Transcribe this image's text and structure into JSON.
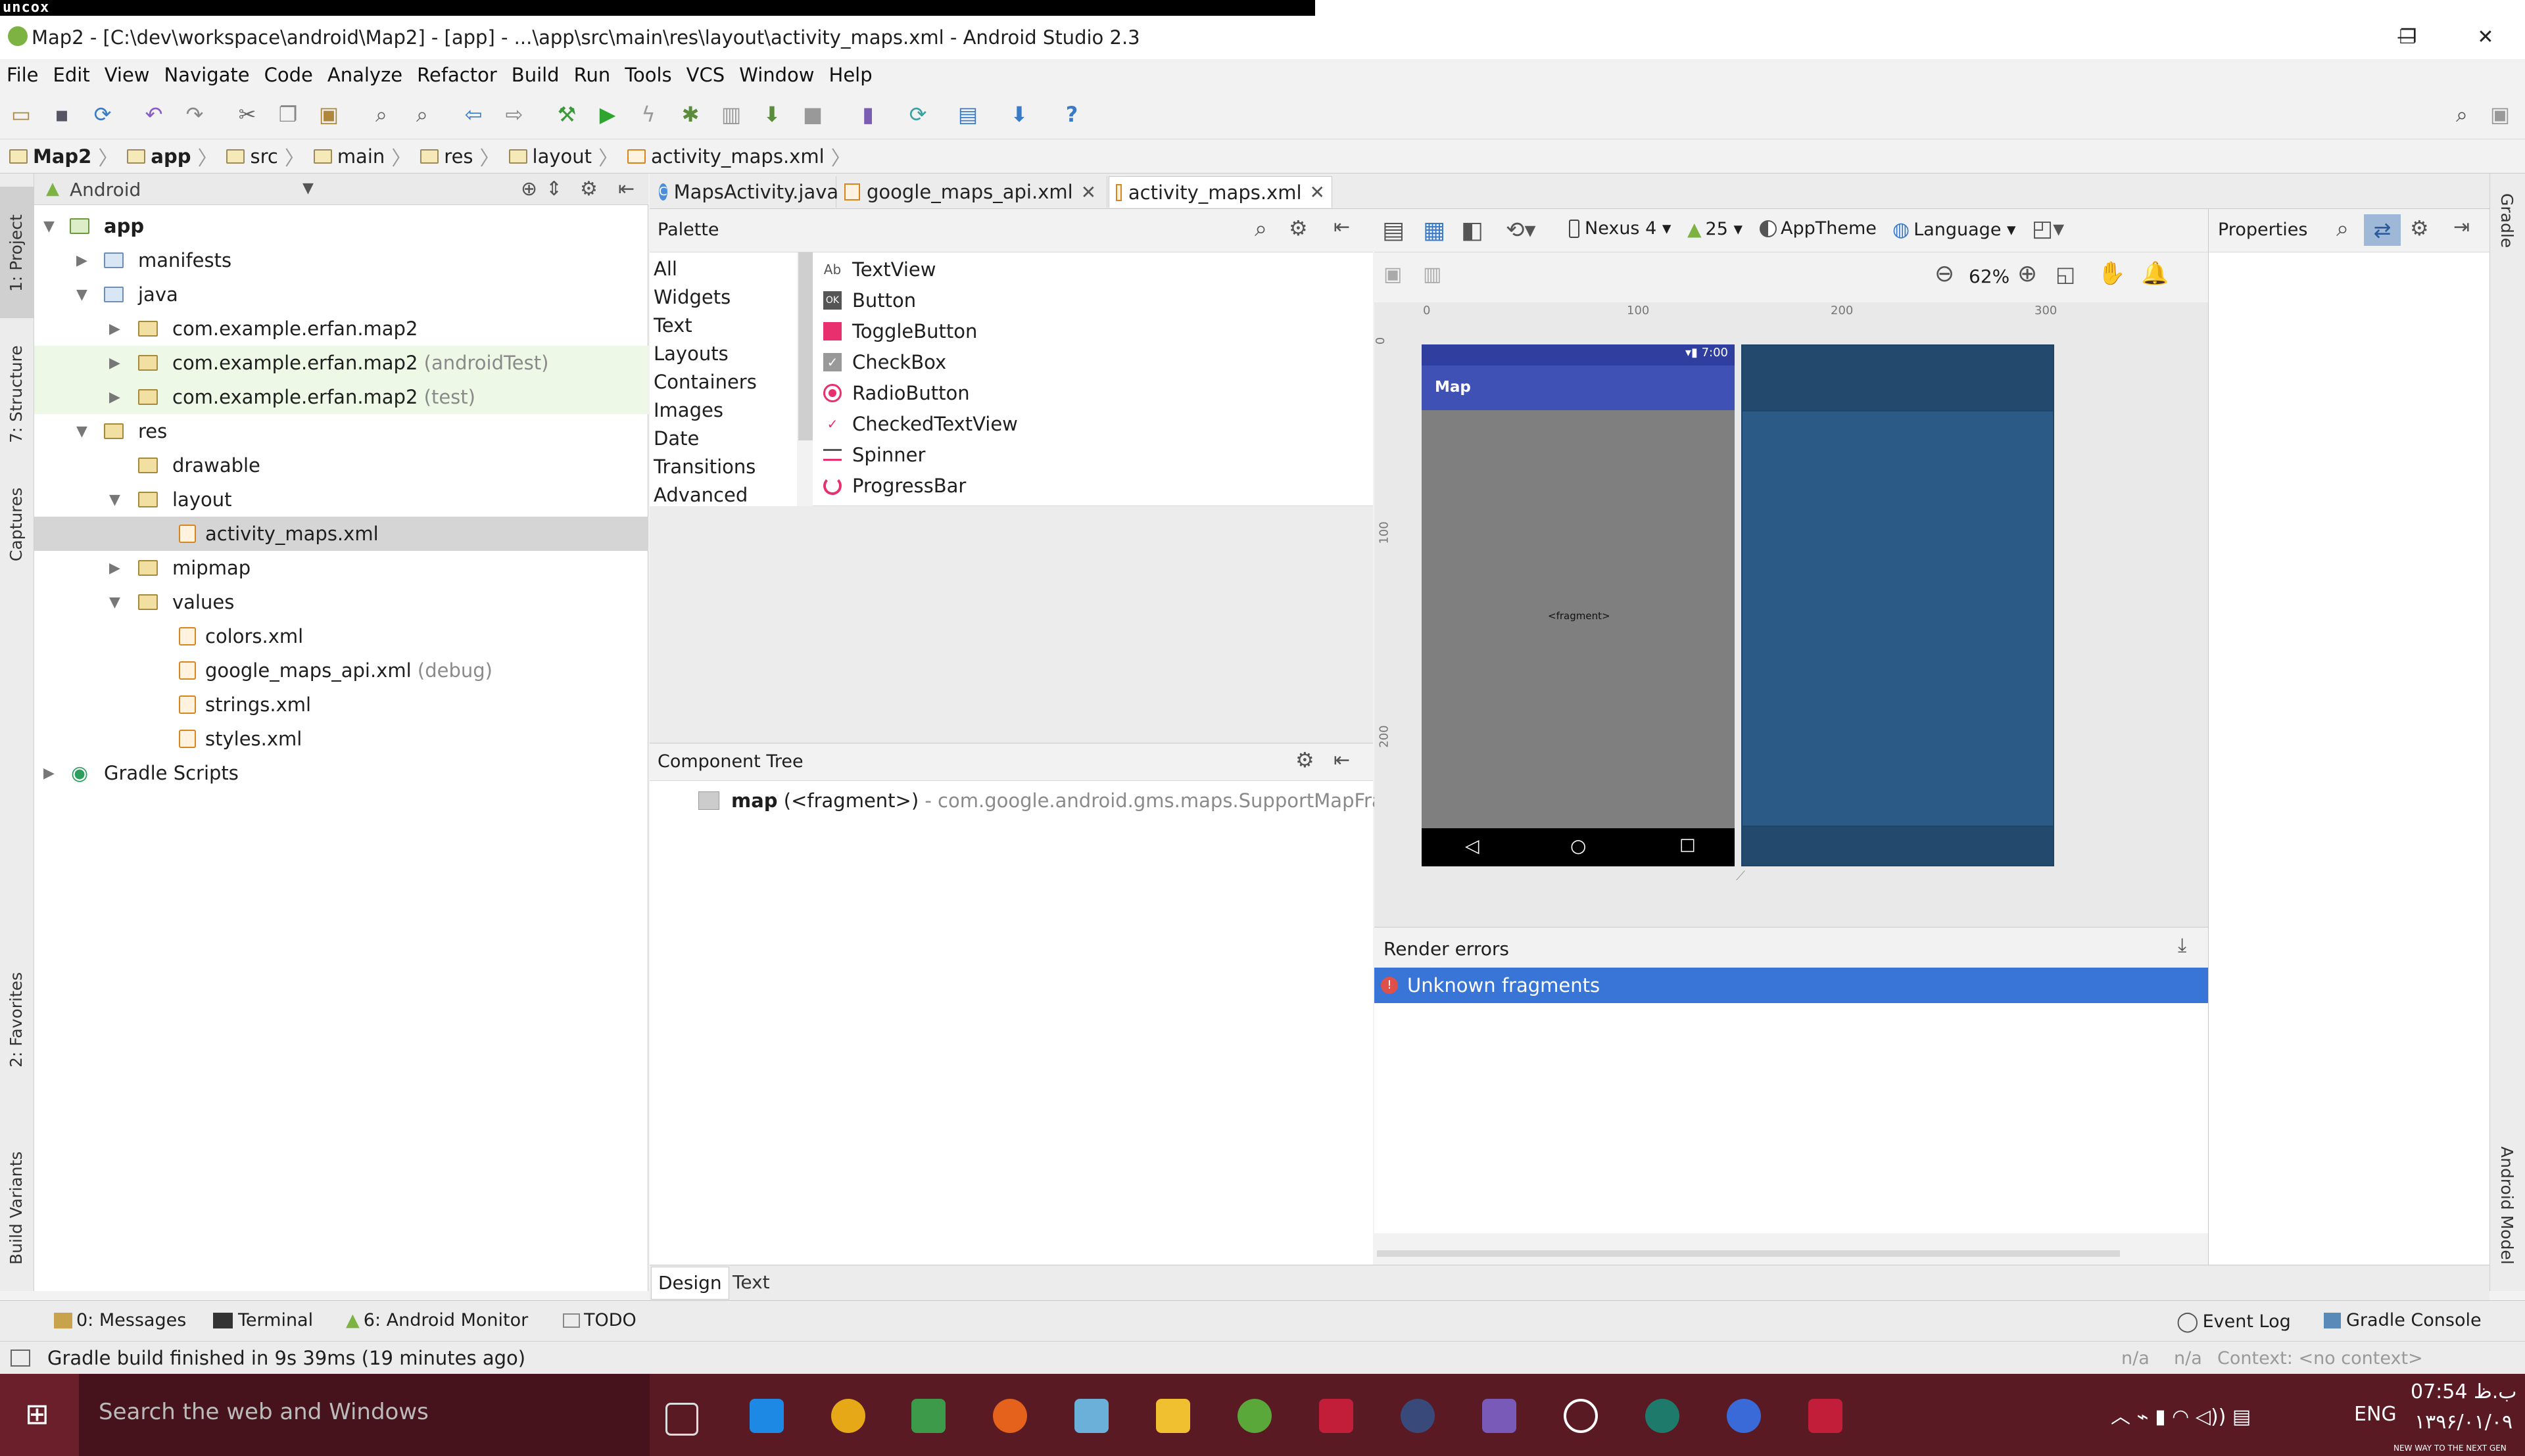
{
  "top_strip": {
    "brand": "uncox"
  },
  "window": {
    "title": "Map2 - [C:\\dev\\workspace\\android\\Map2] - [app] - ...\\app\\src\\main\\res\\layout\\activity_maps.xml - Android Studio 2.3",
    "controls": {
      "minimize": "—",
      "maximize": "❐",
      "close": "✕"
    }
  },
  "menu": [
    "File",
    "Edit",
    "View",
    "Navigate",
    "Code",
    "Analyze",
    "Refactor",
    "Build",
    "Run",
    "Tools",
    "VCS",
    "Window",
    "Help"
  ],
  "breadcrumb": [
    "Map2",
    "app",
    "src",
    "main",
    "res",
    "layout",
    "activity_maps.xml"
  ],
  "left_stripe": {
    "project": "1: Project",
    "structure": "7: Structure",
    "captures": "Captures",
    "favorites": "2: Favorites",
    "build_variants": "Build Variants"
  },
  "right_stripe": {
    "gradle": "Gradle",
    "android_model": "Android Model"
  },
  "project": {
    "view_selector": "Android",
    "tree": [
      {
        "label": "app",
        "suffix": ""
      },
      {
        "label": "manifests",
        "suffix": ""
      },
      {
        "label": "java",
        "suffix": ""
      },
      {
        "label": "com.example.erfan.map2",
        "suffix": ""
      },
      {
        "label": "com.example.erfan.map2",
        "suffix": "(androidTest)"
      },
      {
        "label": "com.example.erfan.map2",
        "suffix": "(test)"
      },
      {
        "label": "res",
        "suffix": ""
      },
      {
        "label": "drawable",
        "suffix": ""
      },
      {
        "label": "layout",
        "suffix": ""
      },
      {
        "label": "activity_maps.xml",
        "suffix": ""
      },
      {
        "label": "mipmap",
        "suffix": ""
      },
      {
        "label": "values",
        "suffix": ""
      },
      {
        "label": "colors.xml",
        "suffix": ""
      },
      {
        "label": "google_maps_api.xml",
        "suffix": "(debug)"
      },
      {
        "label": "strings.xml",
        "suffix": ""
      },
      {
        "label": "styles.xml",
        "suffix": ""
      },
      {
        "label": "Gradle Scripts",
        "suffix": ""
      }
    ]
  },
  "editor_tabs": [
    {
      "label": "MapsActivity.java"
    },
    {
      "label": "google_maps_api.xml"
    },
    {
      "label": "activity_maps.xml"
    }
  ],
  "palette": {
    "title": "Palette",
    "categories": [
      "All",
      "Widgets",
      "Text",
      "Layouts",
      "Containers",
      "Images",
      "Date",
      "Transitions",
      "Advanced"
    ],
    "items": [
      {
        "icon": "Ab",
        "label": "TextView"
      },
      {
        "icon": "OK",
        "label": "Button"
      },
      {
        "icon": "",
        "label": "ToggleButton"
      },
      {
        "icon": "✓",
        "label": "CheckBox"
      },
      {
        "icon": "",
        "label": "RadioButton"
      },
      {
        "icon": "✓",
        "label": "CheckedTextView"
      },
      {
        "icon": "",
        "label": "Spinner"
      },
      {
        "icon": "",
        "label": "ProgressBar"
      }
    ]
  },
  "component_tree": {
    "title": "Component Tree",
    "node": {
      "id": "map",
      "type": "(<fragment>)",
      "class": "- com.google.android.gms.maps.SupportMapFragmen"
    }
  },
  "design_toolbar": {
    "device": "Nexus 4",
    "api": "25",
    "theme": "AppTheme",
    "language": "Language",
    "zoom": "62%"
  },
  "rulers": {
    "h": [
      "0",
      "100",
      "200",
      "300"
    ],
    "v": [
      "0",
      "100",
      "200"
    ]
  },
  "phone": {
    "time": "7:00",
    "app_title": "Map",
    "fragment_label": "<fragment>",
    "nav": {
      "back": "◁",
      "home": "○",
      "recent": "□"
    }
  },
  "properties": {
    "title": "Properties"
  },
  "render": {
    "title": "Render errors",
    "error": "Unknown fragments"
  },
  "design_tabs": {
    "design": "Design",
    "text": "Text"
  },
  "tools": {
    "messages": "0: Messages",
    "terminal": "Terminal",
    "monitor": "6: Android Monitor",
    "todo": "TODO",
    "event_log": "Event Log",
    "gradle_console": "Gradle Console"
  },
  "status": {
    "message": "Gradle build finished in 9s 39ms (19 minutes ago)",
    "na1": "n/a",
    "na2": "n/a",
    "context": "Context: <no context>"
  },
  "taskbar": {
    "search_placeholder": "Search the web and Windows",
    "lang": "ENG",
    "time": "07:54 ب.ظ",
    "date": "۱۳۹۶/۰۱/۰۹",
    "corner_text": "NEW WAY TO THE NEXT GEN"
  },
  "colors": {
    "accent_blue": "#3875d7",
    "phone_primary": "#3f51b5",
    "phone_status": "#303f9f",
    "blueprint": "#2a5a85",
    "taskbar": "#5a1a24"
  }
}
